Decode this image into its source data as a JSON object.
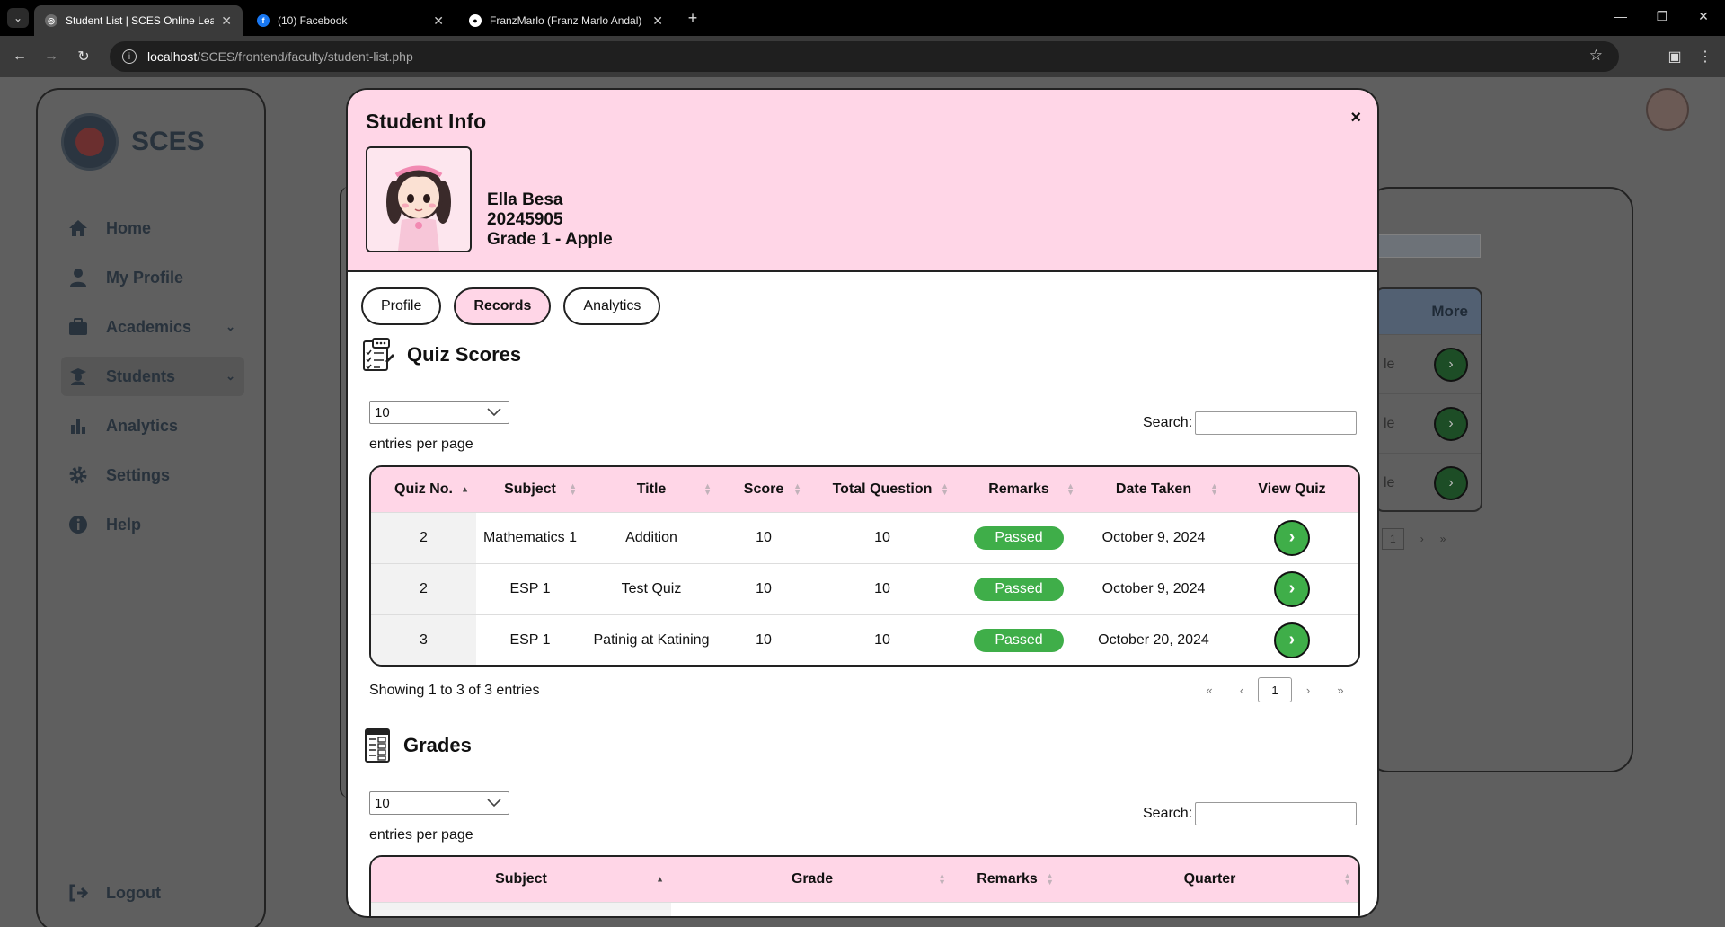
{
  "browser": {
    "tabs": [
      {
        "title": "Student List | SCES Online Lear",
        "active": true,
        "favicon": "globe-icon"
      },
      {
        "title": "(10) Facebook",
        "active": false,
        "favicon": "facebook-icon"
      },
      {
        "title": "FranzMarlo (Franz Marlo Andal)",
        "active": false,
        "favicon": "github-icon"
      }
    ],
    "url_host": "localhost",
    "url_path": "/SCES/frontend/faculty/student-list.php"
  },
  "sidebar": {
    "brand": "SCES",
    "items": [
      {
        "label": "Home",
        "icon": "home-icon"
      },
      {
        "label": "My Profile",
        "icon": "user-icon"
      },
      {
        "label": "Academics",
        "icon": "briefcase-icon"
      },
      {
        "label": "Students",
        "icon": "student-icon"
      },
      {
        "label": "Analytics",
        "icon": "bar-chart-icon"
      },
      {
        "label": "Settings",
        "icon": "gear-icon"
      },
      {
        "label": "Help",
        "icon": "info-icon"
      }
    ],
    "logout": "Logout"
  },
  "background": {
    "table_header": "More",
    "row_text": [
      "le",
      "le",
      "le"
    ],
    "page": "1"
  },
  "modal": {
    "title": "Student Info",
    "close": "×",
    "student": {
      "name": "Ella Besa",
      "id": "20245905",
      "section": "Grade 1 - Apple"
    },
    "tabs": [
      "Profile",
      "Records",
      "Analytics"
    ],
    "active_tab": "Records",
    "quiz": {
      "title": "Quiz Scores",
      "length": "10",
      "length_label": "entries per page",
      "search_label": "Search:",
      "search_value": "",
      "columns": [
        "Quiz No.",
        "Subject",
        "Title",
        "Score",
        "Total Question",
        "Remarks",
        "Date Taken",
        "View Quiz"
      ],
      "rows": [
        {
          "quiz_no": "2",
          "subject": "Mathematics 1",
          "title": "Addition",
          "score": "10",
          "total": "10",
          "remarks": "Passed",
          "date": "October 9, 2024"
        },
        {
          "quiz_no": "2",
          "subject": "ESP 1",
          "title": "Test Quiz",
          "score": "10",
          "total": "10",
          "remarks": "Passed",
          "date": "October 9, 2024"
        },
        {
          "quiz_no": "3",
          "subject": "ESP 1",
          "title": "Patinig at Katining",
          "score": "10",
          "total": "10",
          "remarks": "Passed",
          "date": "October 20, 2024"
        }
      ],
      "info": "Showing 1 to 3 of 3 entries",
      "pager": {
        "first": "«",
        "prev": "‹",
        "current": "1",
        "next": "›",
        "last": "»"
      }
    },
    "grades": {
      "title": "Grades",
      "length": "10",
      "length_label": "entries per page",
      "search_label": "Search:",
      "search_value": "",
      "columns": [
        "Subject",
        "Grade",
        "Remarks",
        "Quarter"
      ]
    }
  },
  "colors": {
    "accent_pink": "#ffd6e7",
    "passed_green": "#3fae49"
  }
}
